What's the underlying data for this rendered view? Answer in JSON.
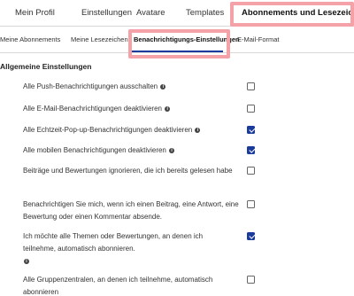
{
  "top_tabs": [
    {
      "label": "Mein Profil",
      "active": false
    },
    {
      "label": "Einstellungen",
      "active": false
    },
    {
      "label": "Avatare",
      "active": false
    },
    {
      "label": "Templates",
      "active": false
    },
    {
      "label": "Abonnements und Lesezeichen",
      "active": true
    }
  ],
  "sub_tabs": [
    {
      "label": "Meine Abonnements",
      "active": false
    },
    {
      "label": "Meine Lesezeichen",
      "active": false
    },
    {
      "label": "Benachrichtigungs-Einstellungen",
      "active": true
    },
    {
      "label": "E-Mail-Format",
      "active": false
    }
  ],
  "section_title": "Allgemeine Einstellungen",
  "settings": [
    {
      "label": "Alle Push-Benachrichtigungen ausschalten",
      "info": true,
      "checked": false
    },
    {
      "label": "Alle E-Mail-Benachrichtigungen deaktivieren",
      "info": true,
      "checked": false
    },
    {
      "label": "Alle Echtzeit-Pop-up-Benachrichtigungen deaktivieren",
      "info": true,
      "checked": true
    },
    {
      "label": "Alle mobilen Benachrichtigungen deaktivieren",
      "info": true,
      "checked": true
    },
    {
      "label": "Beiträge und Bewertungen ignorieren, die ich bereits gelesen habe",
      "info": false,
      "checked": false
    },
    {
      "label": "Benachrichtigen Sie mich, wenn ich einen Beitrag, eine Antwort, eine Bewertung oder einen Kommentar absende.",
      "info": false,
      "checked": false
    },
    {
      "label": "Ich möchte alle Themen oder Bewertungen, an denen ich teilnehme, automatisch abonnieren.",
      "info": true,
      "checked": true
    },
    {
      "label": "Alle Gruppenzentralen, an denen ich teilnehme, automatisch abonnieren",
      "info": false,
      "checked": false
    }
  ],
  "icons": {
    "info": "info-icon",
    "checkbox": "checkbox"
  },
  "colors": {
    "accent": "#1a3b9b",
    "highlight": "#f4a1a8"
  }
}
